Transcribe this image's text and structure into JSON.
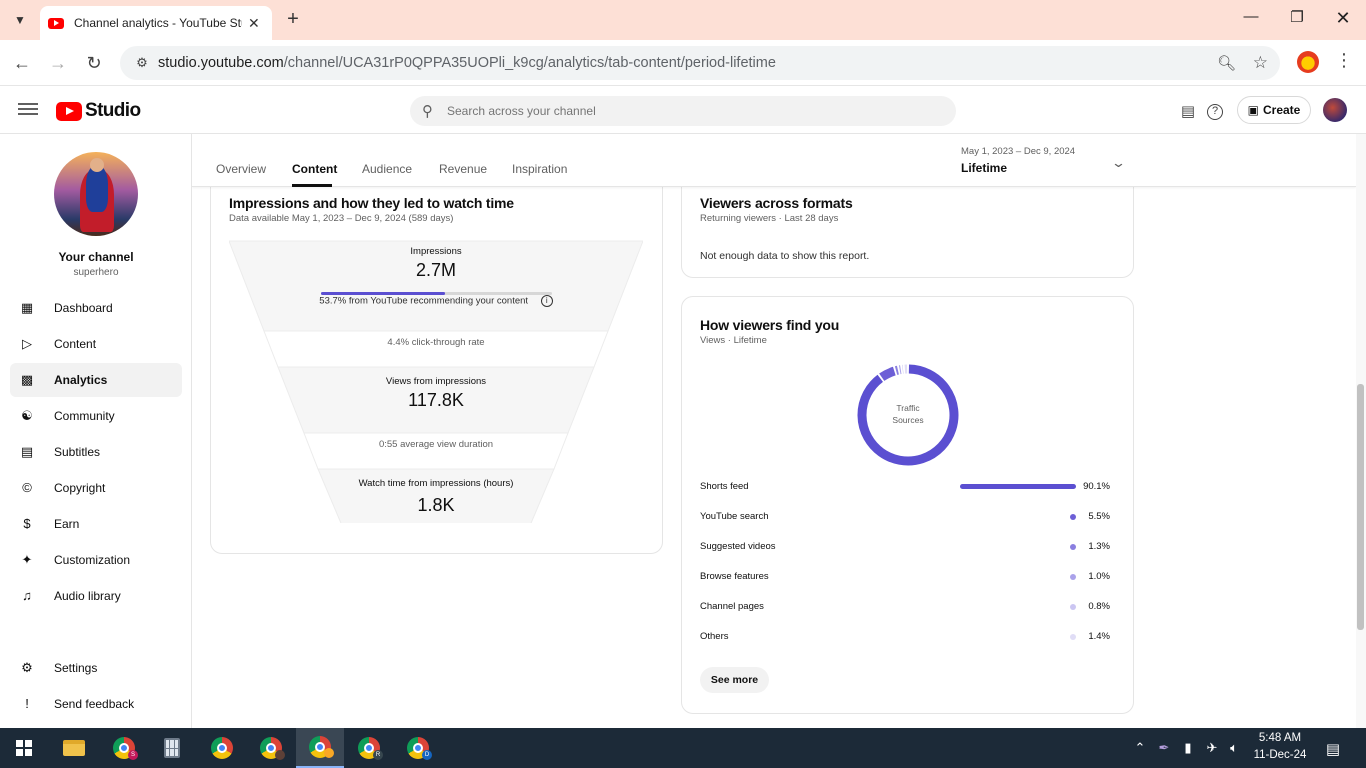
{
  "browser": {
    "tab_title": "Channel analytics - YouTube Studio",
    "url_host": "studio.youtube.com",
    "url_path": "/channel/UCA31rP0QPPA35UOPli_k9cg/analytics/tab-content/period-lifetime"
  },
  "studio": {
    "logo_text": "Studio",
    "search_placeholder": "Search across your channel",
    "create_label": "Create"
  },
  "sidebar": {
    "channel_label": "Your channel",
    "channel_handle": "superhero",
    "items": [
      {
        "label": "Dashboard",
        "icon": "dashboard-icon"
      },
      {
        "label": "Content",
        "icon": "content-icon"
      },
      {
        "label": "Analytics",
        "icon": "analytics-icon",
        "active": true
      },
      {
        "label": "Community",
        "icon": "community-icon"
      },
      {
        "label": "Subtitles",
        "icon": "subtitles-icon"
      },
      {
        "label": "Copyright",
        "icon": "copyright-icon"
      },
      {
        "label": "Earn",
        "icon": "dollar-icon"
      },
      {
        "label": "Customization",
        "icon": "magic-wand-icon"
      },
      {
        "label": "Audio library",
        "icon": "audio-library-icon"
      }
    ],
    "footer": [
      {
        "label": "Settings",
        "icon": "gear-icon"
      },
      {
        "label": "Send feedback",
        "icon": "feedback-icon"
      }
    ]
  },
  "analytics": {
    "tabs": [
      "Overview",
      "Content",
      "Audience",
      "Revenue",
      "Inspiration"
    ],
    "active_tab": "Content",
    "period_range": "May 1, 2023 – Dec 9, 2024",
    "period_value": "Lifetime"
  },
  "impressions_card": {
    "title": "Impressions and how they led to watch time",
    "subtitle": "Data available May 1, 2023 – Dec 9, 2024 (589 days)",
    "impressions_label": "Impressions",
    "impressions_value": "2.7M",
    "impressions_bar_fraction": 0.537,
    "recommend_text": "53.7% from YouTube recommending your content",
    "ctr_text": "4.4% click-through rate",
    "views_label": "Views from impressions",
    "views_value": "117.8K",
    "avd_text": "0:55 average view duration",
    "watch_label": "Watch time from impressions (hours)",
    "watch_value": "1.8K"
  },
  "formats_card": {
    "title": "Viewers across formats",
    "subtitle": "Returning viewers · Last 28 days",
    "message": "Not enough data to show this report."
  },
  "traffic_card": {
    "title": "How viewers find you",
    "subtitle": "Views · Lifetime",
    "donut_label_line1": "Traffic",
    "donut_label_line2": "Sources",
    "see_more": "See more",
    "sources": [
      {
        "name": "Shorts feed",
        "pct": "90.1%",
        "value": 90.1,
        "color": "#5b4fd1"
      },
      {
        "name": "YouTube search",
        "pct": "5.5%",
        "value": 5.5,
        "color": "#6d5fd6"
      },
      {
        "name": "Suggested videos",
        "pct": "1.3%",
        "value": 1.3,
        "color": "#8a7fe0"
      },
      {
        "name": "Browse features",
        "pct": "1.0%",
        "value": 1.0,
        "color": "#aaa2ea"
      },
      {
        "name": "Channel pages",
        "pct": "0.8%",
        "value": 0.8,
        "color": "#cbc6f2"
      },
      {
        "name": "Others",
        "pct": "1.4%",
        "value": 1.4,
        "color": "#e0ddf6"
      }
    ]
  },
  "taskbar": {
    "time": "5:48 AM",
    "date": "11-Dec-24"
  }
}
